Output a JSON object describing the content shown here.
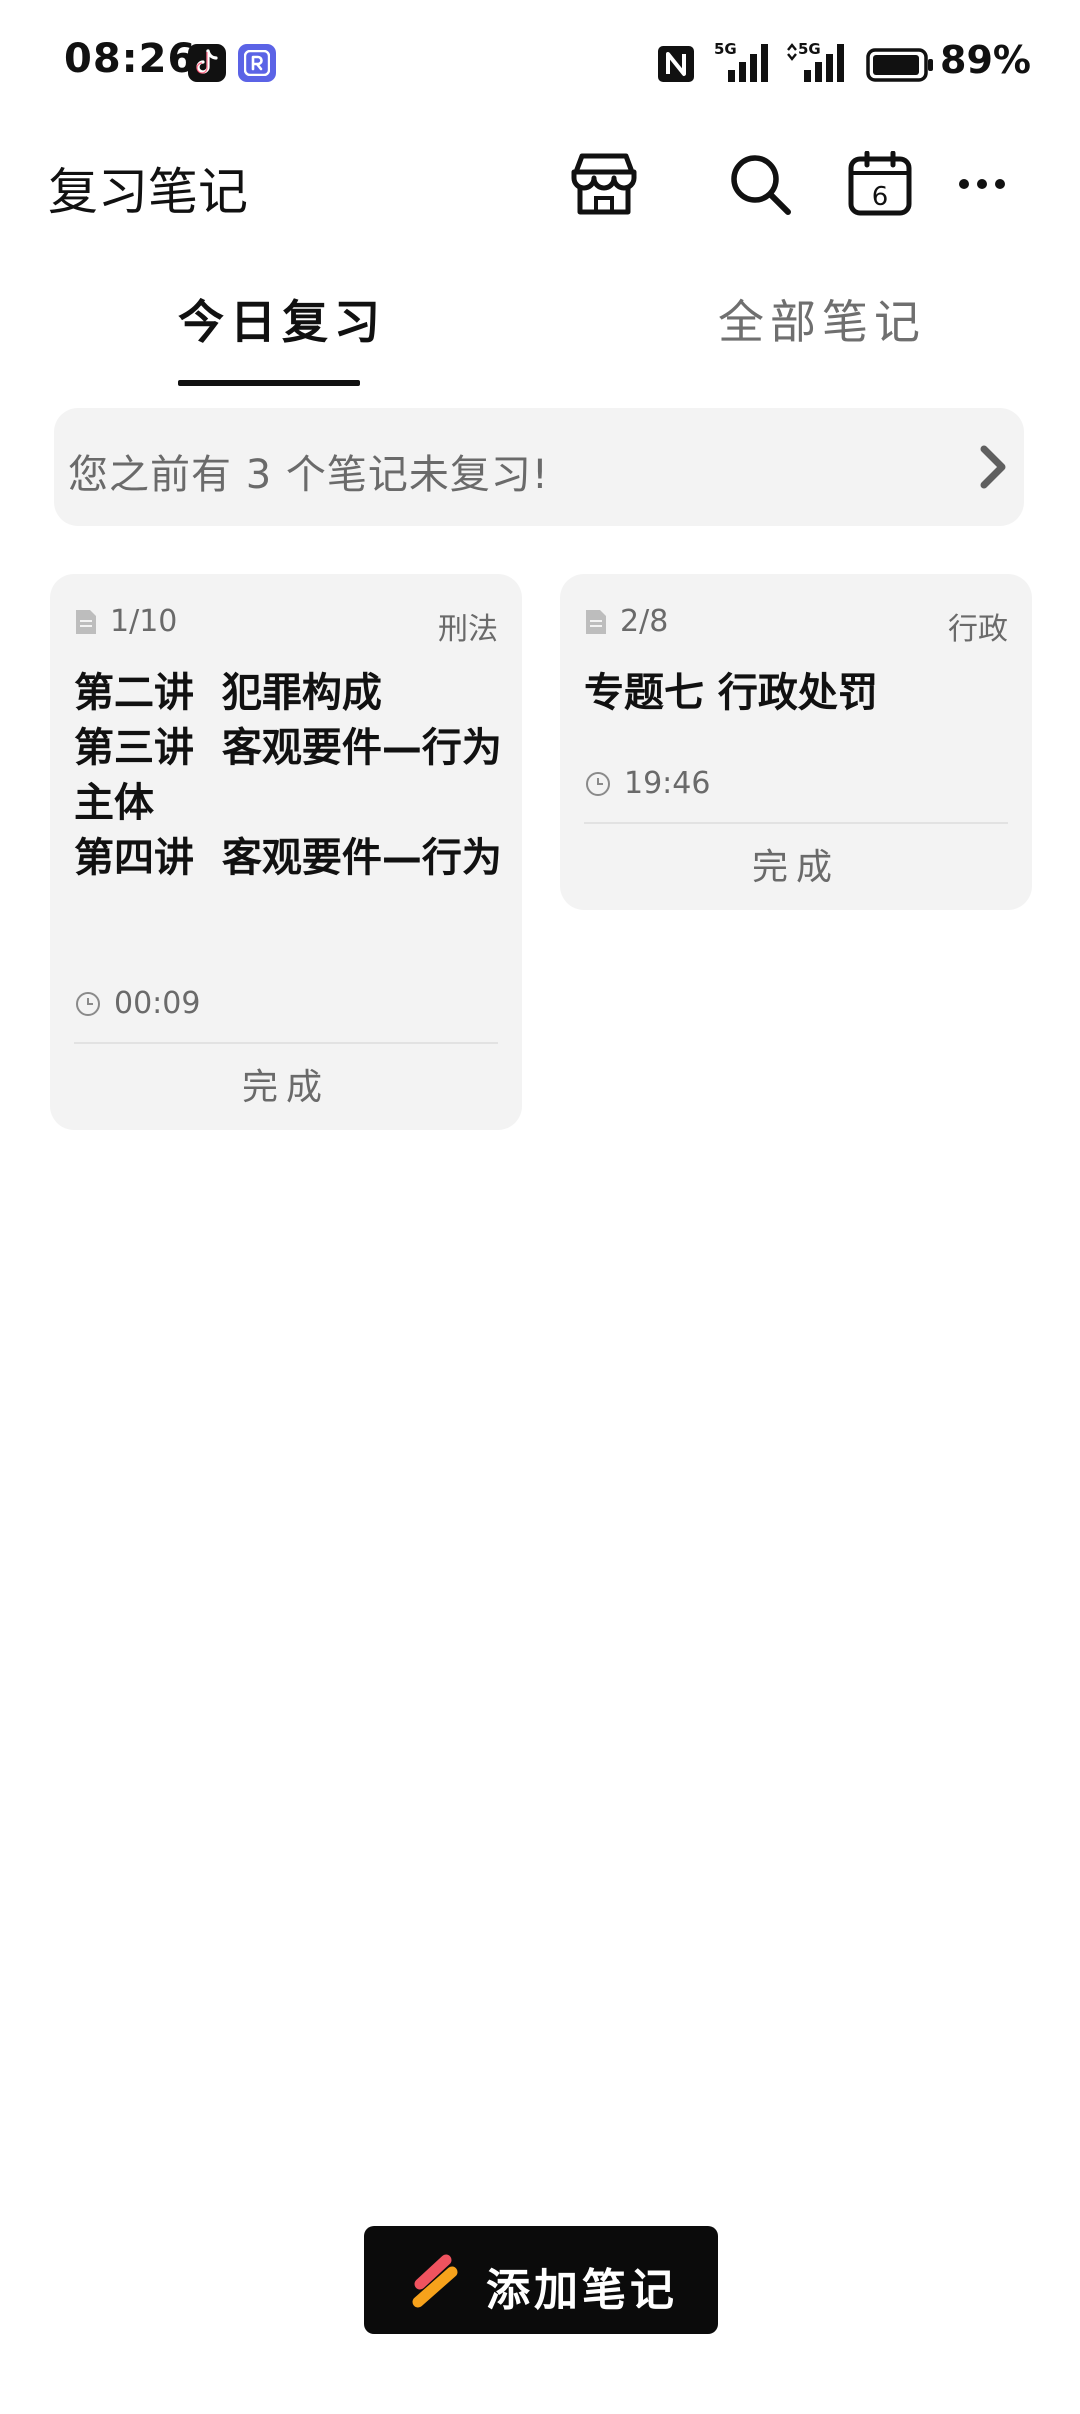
{
  "status_bar": {
    "time": "08:26",
    "battery": "89%",
    "signal_label_1": "5G",
    "signal_label_2": "5G"
  },
  "header": {
    "title": "复习笔记",
    "calendar_day": "6"
  },
  "tabs": [
    {
      "label": "今日复习",
      "active": true
    },
    {
      "label": "全部笔记",
      "active": false
    }
  ],
  "notice": {
    "text": "您之前有 3 个笔记未复习!"
  },
  "cards": [
    {
      "count": "1/10",
      "subject": "刑法",
      "title": "第二讲  犯罪构成\n第三讲  客观要件—行为主体\n第四讲  客观要件—行为",
      "time": "00:09",
      "action": "完成"
    },
    {
      "count": "2/8",
      "subject": "行政",
      "title": "专题七  行政处罚",
      "time": "19:46",
      "action": "完成"
    }
  ],
  "add_button": {
    "label": "添加笔记"
  },
  "colors": {
    "accent": "#111111",
    "card_bg": "#f3f3f3",
    "muted_text": "#6a6a6a",
    "button_bg": "#0b0b0b",
    "pen_red": "#f0535f",
    "pen_orange": "#f7a21b"
  }
}
